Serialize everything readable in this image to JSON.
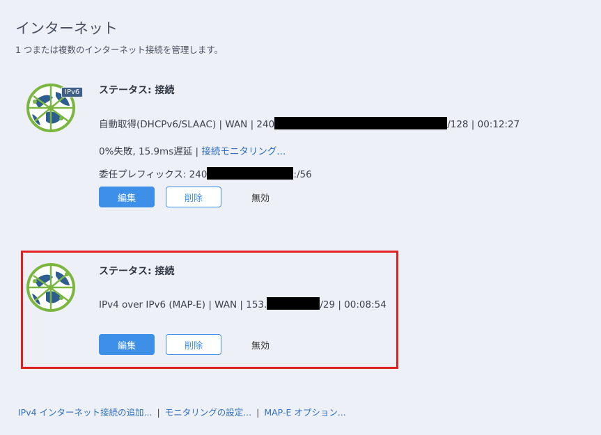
{
  "page": {
    "title": "インターネット",
    "subtitle": "1 つまたは複数のインターネット接続を管理します。"
  },
  "connections": [
    {
      "badge": "IPv6",
      "status": "ステータス: 接続",
      "detail_prefix": "自動取得(DHCPv6/SLAAC) | WAN | 240",
      "detail_suffix": "/128 | 00:12:27",
      "stats": "0%失敗, 15.9ms遅延 |",
      "monitor_link": "接続モニタリング...",
      "prefix_label": "委任プレフィックス: 240",
      "prefix_suffix": ":/56",
      "edit": "編集",
      "delete": "削除",
      "disable": "無効"
    },
    {
      "status": "ステータス: 接続",
      "detail_prefix": "IPv4 over IPv6 (MAP-E) | WAN | 153.",
      "detail_suffix": "/29 | 00:08:54",
      "edit": "編集",
      "delete": "削除",
      "disable": "無効"
    }
  ],
  "footer": {
    "add_ipv4": "IPv4 インターネット接続の追加...",
    "monitoring": "モニタリングの設定...",
    "mape": "MAP-E オプション...",
    "separator": "|"
  },
  "colors": {
    "accent": "#3d8fe8",
    "highlight": "#e02020",
    "globe_green": "#7ab640",
    "globe_blue": "#2e5d8f"
  }
}
